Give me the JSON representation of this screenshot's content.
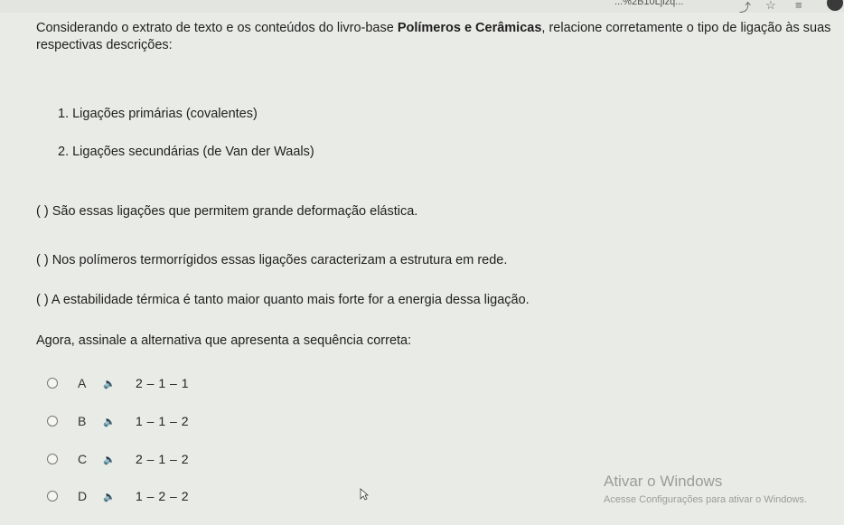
{
  "browser": {
    "url_fragment": "...%2B10Ljizq...",
    "icons": [
      "share-icon",
      "star-icon",
      "reading-list-icon",
      "avatar"
    ]
  },
  "question": {
    "text_before": "Considerando o extrato de texto e os conteúdos do livro-base ",
    "bold": "Polímeros e Cerâmicas",
    "text_after": ", relacione corretamente o tipo de ligação às suas respectivas descrições:"
  },
  "items": [
    "1. Ligações primárias (covalentes)",
    "2. Ligações secundárias (de Van der Waals)"
  ],
  "statements": [
    "(  ) São essas ligações que permitem grande deformação elástica.",
    "(  ) Nos polímeros termorrígidos essas ligações caracterizam a estrutura em rede.",
    "(  ) A estabilidade térmica é tanto maior quanto mais forte for a energia dessa ligação."
  ],
  "prompt": "Agora, assinale a alternativa que apresenta a sequência correta:",
  "options": [
    {
      "letter": "A",
      "value": "2 – 1 – 1"
    },
    {
      "letter": "B",
      "value": "1 – 1 – 2"
    },
    {
      "letter": "C",
      "value": "2 – 1 – 2"
    },
    {
      "letter": "D",
      "value": "1 – 2 – 2"
    }
  ],
  "watermark": {
    "title": "Ativar o Windows",
    "subtitle": "Acesse Configurações para ativar o Windows."
  }
}
